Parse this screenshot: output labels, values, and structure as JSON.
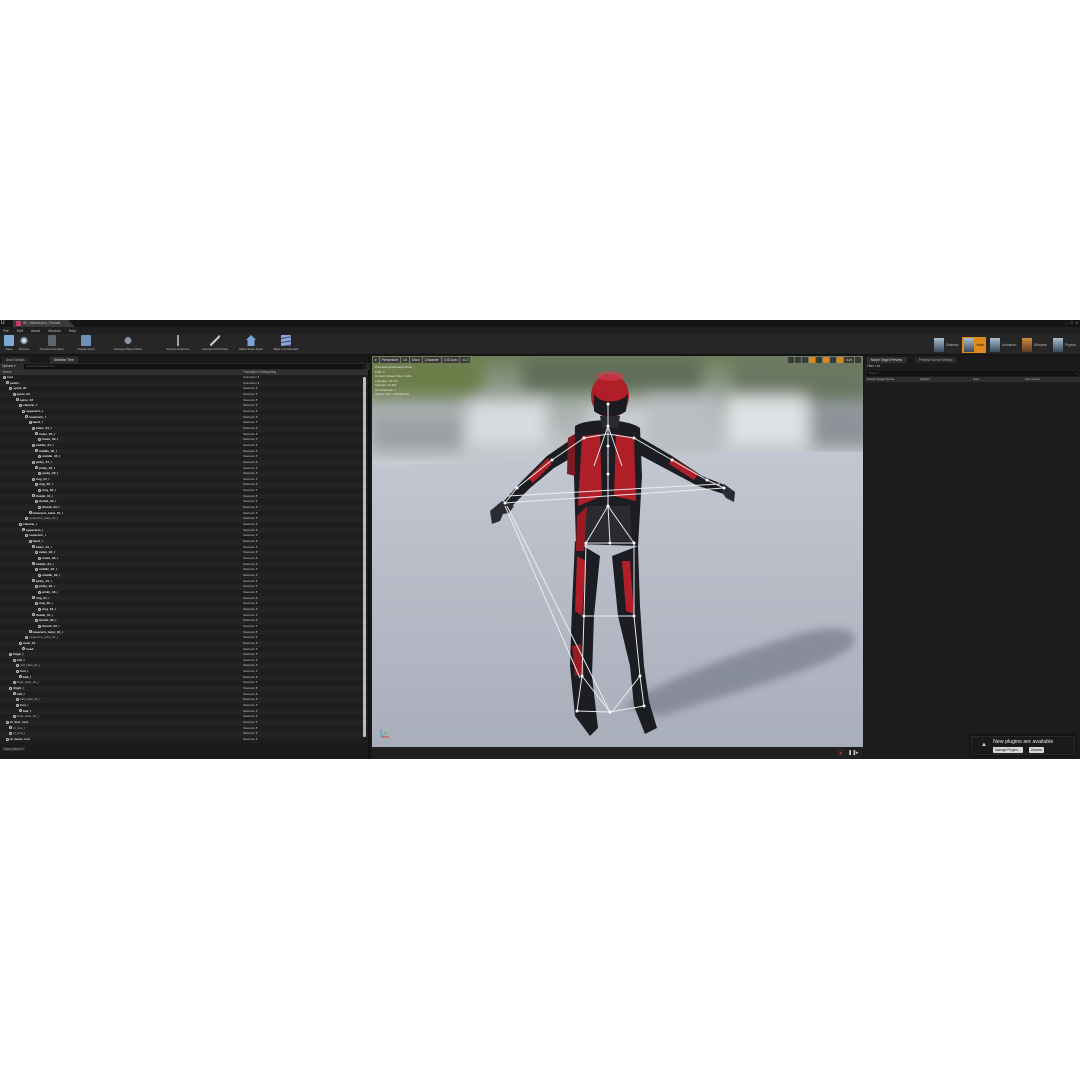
{
  "window": {
    "title": "SK_Mannequin_Female",
    "controls": [
      "-",
      "□",
      "×"
    ]
  },
  "menu": [
    "File",
    "Edit",
    "Asset",
    "Window",
    "Help"
  ],
  "toolbar": {
    "buttons": [
      {
        "label": "Save",
        "icon": "save-icon",
        "color": "#7da9d8"
      },
      {
        "label": "Browse",
        "icon": "browse-icon",
        "color": "#8fb0cc"
      },
      {
        "label": "Preview Animation",
        "icon": "run-icon",
        "color": "#9aa5b0"
      },
      {
        "label": "Create Asset",
        "icon": "create-asset-icon",
        "color": "#6f8fb8"
      },
      {
        "label": "Retarget Base Mesh",
        "icon": "retarget-icon",
        "color": "#8a96a3"
      },
      {
        "label": "Section Selection",
        "icon": "section-icon",
        "color": "#9aa0a6"
      },
      {
        "label": "Activate Cloth Paint",
        "icon": "brush-icon",
        "color": "#b8b8b8"
      },
      {
        "label": "Make Static Mesh",
        "icon": "house-icon",
        "color": "#7ea3d6"
      },
      {
        "label": "Bake out Materials",
        "icon": "layers-icon",
        "color": "#8fa2d6"
      }
    ],
    "modes": [
      {
        "label": "Skeleton",
        "active": false
      },
      {
        "label": "Mesh",
        "active": true
      },
      {
        "label": "Animation",
        "active": false
      },
      {
        "label": "Blueprint",
        "active": false
      },
      {
        "label": "Physics",
        "active": false
      }
    ]
  },
  "left_panel": {
    "tabs": [
      "Asset Details",
      "Skeleton Tree"
    ],
    "options_label": "Options ▾",
    "search_placeholder": "Search Skeleton Tree...",
    "columns": [
      "Name",
      "Translation Retargeting"
    ],
    "rows": [
      {
        "name": "root",
        "depth": 0,
        "ret": "Animation ▾"
      },
      {
        "name": "pelvis",
        "depth": 1,
        "ret": "Animation ▾"
      },
      {
        "name": "spine_01",
        "depth": 2,
        "ret": "Skeleton ▾"
      },
      {
        "name": "spine_02",
        "depth": 3,
        "ret": "Skeleton ▾"
      },
      {
        "name": "spine_03",
        "depth": 4,
        "ret": "Skeleton ▾"
      },
      {
        "name": "clavicle_l",
        "depth": 5,
        "ret": "Skeleton ▾"
      },
      {
        "name": "upperarm_l",
        "depth": 6,
        "ret": "Skeleton ▾"
      },
      {
        "name": "lowerarm_l",
        "depth": 7,
        "ret": "Skeleton ▾"
      },
      {
        "name": "hand_l",
        "depth": 8,
        "ret": "Skeleton ▾"
      },
      {
        "name": "index_01_l",
        "depth": 9,
        "ret": "Skeleton ▾"
      },
      {
        "name": "index_02_l",
        "depth": 10,
        "ret": "Skeleton ▾"
      },
      {
        "name": "index_03_l",
        "depth": 11,
        "ret": "Skeleton ▾"
      },
      {
        "name": "middle_01_l",
        "depth": 9,
        "ret": "Skeleton ▾"
      },
      {
        "name": "middle_02_l",
        "depth": 10,
        "ret": "Skeleton ▾"
      },
      {
        "name": "middle_03_l",
        "depth": 11,
        "ret": "Skeleton ▾"
      },
      {
        "name": "pinky_01_l",
        "depth": 9,
        "ret": "Skeleton ▾"
      },
      {
        "name": "pinky_02_l",
        "depth": 10,
        "ret": "Skeleton ▾"
      },
      {
        "name": "pinky_03_l",
        "depth": 11,
        "ret": "Skeleton ▾"
      },
      {
        "name": "ring_01_l",
        "depth": 9,
        "ret": "Skeleton ▾"
      },
      {
        "name": "ring_02_l",
        "depth": 10,
        "ret": "Skeleton ▾"
      },
      {
        "name": "ring_03_l",
        "depth": 11,
        "ret": "Skeleton ▾"
      },
      {
        "name": "thumb_01_l",
        "depth": 9,
        "ret": "Skeleton ▾"
      },
      {
        "name": "thumb_02_l",
        "depth": 10,
        "ret": "Skeleton ▾"
      },
      {
        "name": "thumb_03_l",
        "depth": 11,
        "ret": "Skeleton ▾"
      },
      {
        "name": "lowerarm_twist_01_l",
        "depth": 8,
        "ret": "Skeleton ▾"
      },
      {
        "name": "upperarm_twist_01_l",
        "depth": 7,
        "ret": "Skeleton ▾",
        "plain": true
      },
      {
        "name": "clavicle_r",
        "depth": 5,
        "ret": "Skeleton ▾"
      },
      {
        "name": "upperarm_r",
        "depth": 6,
        "ret": "Skeleton ▾"
      },
      {
        "name": "lowerarm_r",
        "depth": 7,
        "ret": "Skeleton ▾"
      },
      {
        "name": "hand_r",
        "depth": 8,
        "ret": "Skeleton ▾"
      },
      {
        "name": "index_01_r",
        "depth": 9,
        "ret": "Skeleton ▾"
      },
      {
        "name": "index_02_r",
        "depth": 10,
        "ret": "Skeleton ▾"
      },
      {
        "name": "index_03_r",
        "depth": 11,
        "ret": "Skeleton ▾"
      },
      {
        "name": "middle_01_r",
        "depth": 9,
        "ret": "Skeleton ▾"
      },
      {
        "name": "middle_02_r",
        "depth": 10,
        "ret": "Skeleton ▾"
      },
      {
        "name": "middle_03_r",
        "depth": 11,
        "ret": "Skeleton ▾"
      },
      {
        "name": "pinky_01_r",
        "depth": 9,
        "ret": "Skeleton ▾"
      },
      {
        "name": "pinky_02_r",
        "depth": 10,
        "ret": "Skeleton ▾"
      },
      {
        "name": "pinky_03_r",
        "depth": 11,
        "ret": "Skeleton ▾"
      },
      {
        "name": "ring_01_r",
        "depth": 9,
        "ret": "Skeleton ▾"
      },
      {
        "name": "ring_02_r",
        "depth": 10,
        "ret": "Skeleton ▾"
      },
      {
        "name": "ring_03_r",
        "depth": 11,
        "ret": "Skeleton ▾"
      },
      {
        "name": "thumb_01_r",
        "depth": 9,
        "ret": "Skeleton ▾"
      },
      {
        "name": "thumb_02_r",
        "depth": 10,
        "ret": "Skeleton ▾"
      },
      {
        "name": "thumb_03_r",
        "depth": 11,
        "ret": "Skeleton ▾"
      },
      {
        "name": "lowerarm_twist_01_r",
        "depth": 8,
        "ret": "Skeleton ▾"
      },
      {
        "name": "upperarm_twist_01_r",
        "depth": 7,
        "ret": "Skeleton ▾",
        "plain": true
      },
      {
        "name": "neck_01",
        "depth": 5,
        "ret": "Skeleton ▾"
      },
      {
        "name": "head",
        "depth": 6,
        "ret": "Skeleton ▾"
      },
      {
        "name": "thigh_l",
        "depth": 2,
        "ret": "Skeleton ▾"
      },
      {
        "name": "calf_l",
        "depth": 3,
        "ret": "Skeleton ▾"
      },
      {
        "name": "calf_twist_01_l",
        "depth": 4,
        "ret": "Skeleton ▾",
        "plain": true
      },
      {
        "name": "foot_l",
        "depth": 4,
        "ret": "Skeleton ▾"
      },
      {
        "name": "ball_l",
        "depth": 5,
        "ret": "Skeleton ▾"
      },
      {
        "name": "thigh_twist_01_l",
        "depth": 3,
        "ret": "Skeleton ▾",
        "plain": true
      },
      {
        "name": "thigh_r",
        "depth": 2,
        "ret": "Skeleton ▾"
      },
      {
        "name": "calf_r",
        "depth": 3,
        "ret": "Skeleton ▾"
      },
      {
        "name": "calf_twist_01_r",
        "depth": 4,
        "ret": "Skeleton ▾",
        "plain": true
      },
      {
        "name": "foot_r",
        "depth": 4,
        "ret": "Skeleton ▾"
      },
      {
        "name": "ball_r",
        "depth": 5,
        "ret": "Skeleton ▾"
      },
      {
        "name": "thigh_twist_01_r",
        "depth": 3,
        "ret": "Skeleton ▾",
        "plain": true
      },
      {
        "name": "ik_foot_root",
        "depth": 1,
        "ret": "Skeleton ▾"
      },
      {
        "name": "ik_foot_l",
        "depth": 2,
        "ret": "Skeleton ▾",
        "plain": true
      },
      {
        "name": "ik_foot_r",
        "depth": 2,
        "ret": "Skeleton ▾",
        "plain": true
      },
      {
        "name": "ik_hand_root",
        "depth": 1,
        "ret": "Skeleton ▾"
      }
    ],
    "bottom_button": "Show Filters ▾"
  },
  "viewport": {
    "toolbar_left": [
      "▾",
      "Perspective",
      "Lit",
      "Show",
      "Character",
      "LOD Auto",
      "x1.0"
    ],
    "toolbar_right_speed": "0.25",
    "stats": [
      "Previewing Reference Pose",
      "LOD: 0",
      "Current Screen Size: 1.319",
      "Triangles: 32,717",
      "Vertices: 24,487",
      "UV Channels: 1",
      "Approx Size: 119x40x176"
    ],
    "sky_color": "#a9b0ae",
    "floor_color": "#b8bdc8",
    "suit_red": "#b01e28",
    "suit_dark": "#1c1d22"
  },
  "right_panel": {
    "tabs": [
      "Morph Target Preview",
      "Preview Scene Settings"
    ],
    "label": "Filter List",
    "search_placeholder": "Search",
    "columns": [
      "Morph Target Name",
      "Weight",
      "Auto",
      "Vert Count"
    ]
  },
  "notification": {
    "message": "New plugins are available",
    "buttons": [
      "Manage Plugins...",
      "Dismiss"
    ]
  }
}
